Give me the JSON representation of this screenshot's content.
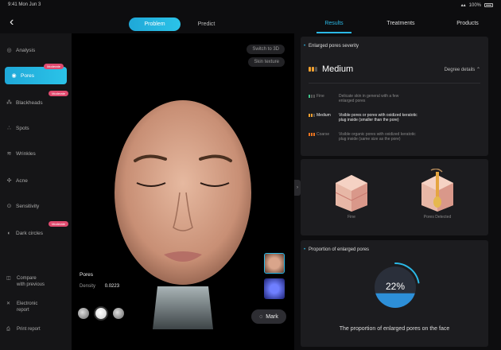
{
  "status_bar": {
    "time": "9:41  Mon Jun 3",
    "battery": "100%"
  },
  "top_tabs": [
    {
      "label": "Problem",
      "active": true
    },
    {
      "label": "Predict",
      "active": false
    }
  ],
  "right_tabs": [
    {
      "label": "Results",
      "active": true
    },
    {
      "label": "Treatments",
      "active": false
    },
    {
      "label": "Products",
      "active": false
    }
  ],
  "sidebar": {
    "items": [
      {
        "label": "Analysis",
        "icon": "analysis-icon",
        "active": false,
        "badge": ""
      },
      {
        "label": "Pores",
        "icon": "pores-icon",
        "active": true,
        "badge": "Moderate"
      },
      {
        "label": "Blackheads",
        "icon": "blackheads-icon",
        "active": false,
        "badge": "Moderate"
      },
      {
        "label": "Spots",
        "icon": "spots-icon",
        "active": false,
        "badge": ""
      },
      {
        "label": "Wrinkles",
        "icon": "wrinkles-icon",
        "active": false,
        "badge": ""
      },
      {
        "label": "Acne",
        "icon": "acne-icon",
        "active": false,
        "badge": ""
      },
      {
        "label": "Sensitivity",
        "icon": "sensitivity-icon",
        "active": false,
        "badge": ""
      },
      {
        "label": "Dark circles",
        "icon": "dark-circles-icon",
        "active": false,
        "badge": "Moderate"
      }
    ],
    "bottom": [
      {
        "label_1": "Compare",
        "label_2": "with previous",
        "icon": "compare-icon"
      },
      {
        "label_1": "Electronic",
        "label_2": "report",
        "icon": "report-icon"
      },
      {
        "label_1": "Print report",
        "label_2": "",
        "icon": "print-icon"
      }
    ]
  },
  "photo": {
    "switch_3d": "Switch to 3D",
    "skin_texture": "Skin texture",
    "info_title": "Pores",
    "density_label": "Density",
    "density_value": "0.0223",
    "mark_label": "Mark"
  },
  "severity": {
    "title": "Enlarged pores severity",
    "level": "Medium",
    "degree_details": "Degree details",
    "legend": [
      {
        "name": "Fine",
        "desc_1": "Delicate skin in general with a few",
        "desc_2": "enlarged pores",
        "highlight": false,
        "color": "#3fc28a"
      },
      {
        "name": "Medium",
        "desc_1": "Visible pores or pores with oxidized keratotic",
        "desc_2": "plug inside (smaller than the pore)",
        "highlight": true,
        "color": "#f0a030"
      },
      {
        "name": "Coarse",
        "desc_1": "Visible organic pores with oxidized keratotic",
        "desc_2": "plug inside (same size as the pore)",
        "highlight": false,
        "color": "#e8731f"
      }
    ]
  },
  "skin_images": [
    {
      "label": "Fine"
    },
    {
      "label": "Pores Detected"
    }
  ],
  "proportion": {
    "title": "Proportion of enlarged pores",
    "value": "22%",
    "fraction": 0.22,
    "description": "The proportion of enlarged pores on the face"
  },
  "colors": {
    "accent": "#2bb8e6",
    "badge": "#e04a6e",
    "medium": "#f0a030"
  }
}
